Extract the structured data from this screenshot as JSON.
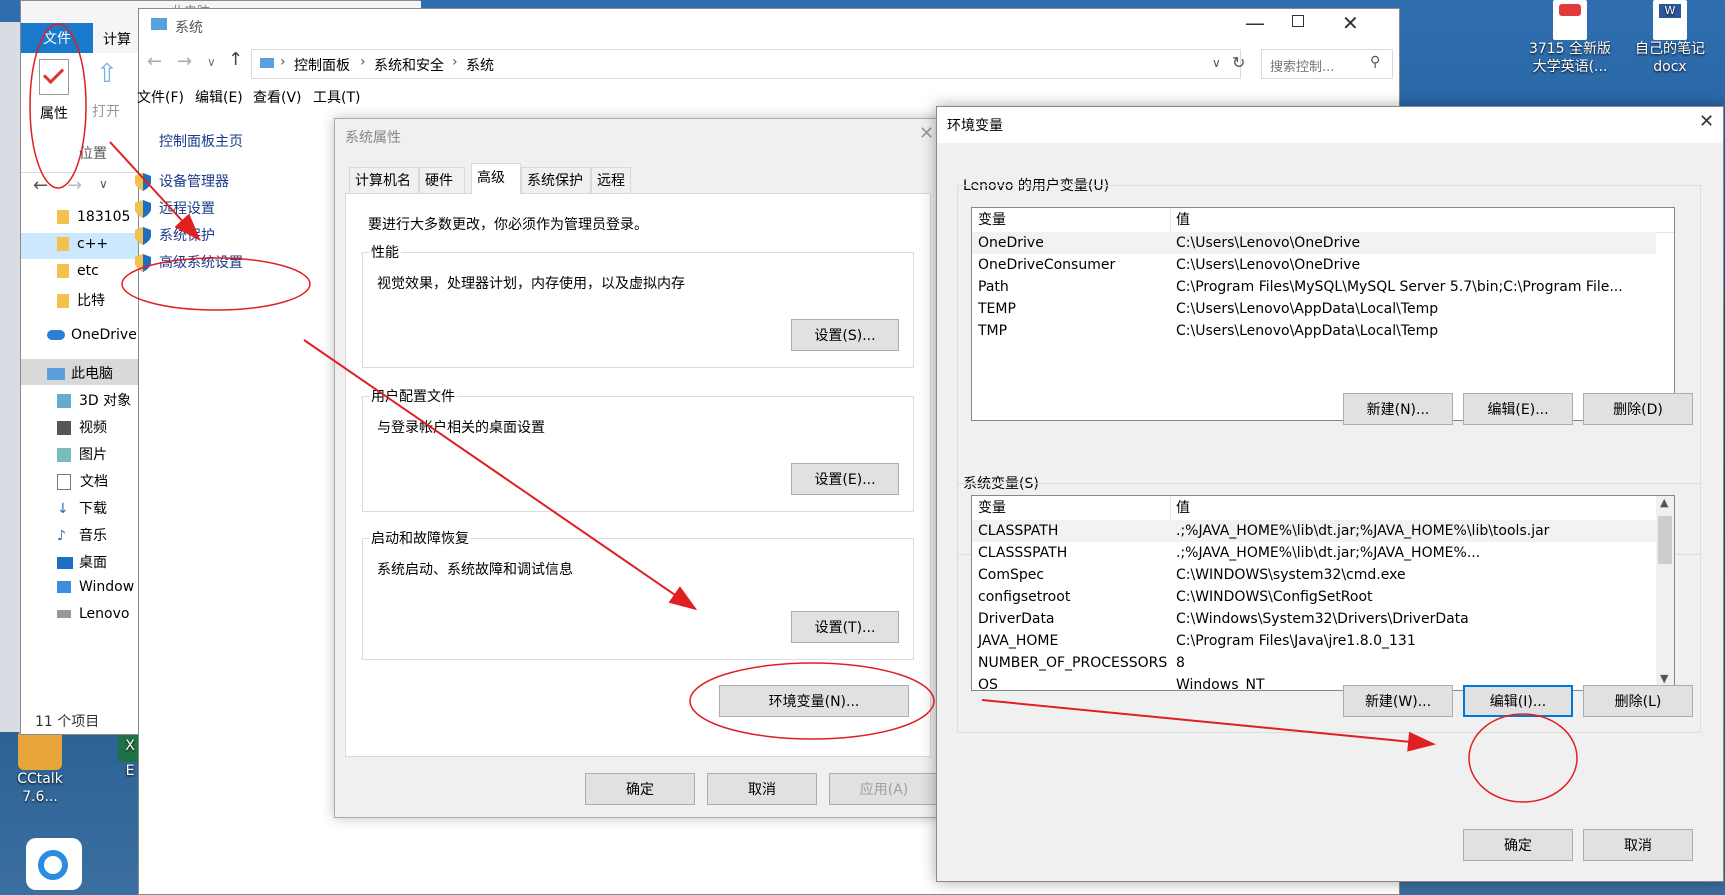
{
  "explorer": {
    "ribbon_tabs": [
      "文件",
      "计算"
    ],
    "ribbon_buttons": [
      "属性",
      "打开"
    ],
    "group_location": "位置",
    "tree_items": [
      "183105",
      "c++",
      "etc",
      "比特",
      "OneDrive",
      "此电脑",
      "3D 对象",
      "视频",
      "图片",
      "文档",
      "下载",
      "音乐",
      "桌面",
      "Window",
      "Lenovo"
    ],
    "status": "11 个项目",
    "title": "此电脑"
  },
  "desktop": {
    "top_icons": [
      {
        "label": "3715 全新版\n大学英语(..."
      },
      {
        "label": "自己的笔记\ndocx"
      }
    ],
    "bottom_icons": [
      {
        "label": "CCtalk 7.6..."
      },
      {
        "label": "E"
      }
    ]
  },
  "system_window": {
    "title": "系统",
    "breadcrumb": [
      "控制面板",
      "系统和安全",
      "系统"
    ],
    "search_placeholder": "搜索控制...",
    "menu": [
      "文件(F)",
      "编辑(E)",
      "查看(V)",
      "工具(T)"
    ],
    "sidebar_home": "控制面板主页",
    "sidebar_links": [
      "设备管理器",
      "远程设置",
      "系统保护",
      "高级系统设置"
    ]
  },
  "sys_props": {
    "title": "系统属性",
    "tabs": [
      "计算机名",
      "硬件",
      "高级",
      "系统保护",
      "远程"
    ],
    "notice": "要进行大多数更改，你必须作为管理员登录。",
    "groups": [
      {
        "title": "性能",
        "desc": "视觉效果，处理器计划，内存使用，以及虚拟内存",
        "button": "设置(S)..."
      },
      {
        "title": "用户配置文件",
        "desc": "与登录帐户相关的桌面设置",
        "button": "设置(E)..."
      },
      {
        "title": "启动和故障恢复",
        "desc": "系统启动、系统故障和调试信息",
        "button": "设置(T)..."
      }
    ],
    "env_button": "环境变量(N)...",
    "ok": "确定",
    "cancel": "取消",
    "apply": "应用(A)"
  },
  "env_vars": {
    "title": "环境变量",
    "user_section": "Lenovo 的用户变量(U)",
    "system_section": "系统变量(S)",
    "col_var": "变量",
    "col_val": "值",
    "user_rows": [
      {
        "name": "OneDrive",
        "value": "C:\\Users\\Lenovo\\OneDrive"
      },
      {
        "name": "OneDriveConsumer",
        "value": "C:\\Users\\Lenovo\\OneDrive"
      },
      {
        "name": "Path",
        "value": "C:\\Program Files\\MySQL\\MySQL Server 5.7\\bin;C:\\Program File..."
      },
      {
        "name": "TEMP",
        "value": "C:\\Users\\Lenovo\\AppData\\Local\\Temp"
      },
      {
        "name": "TMP",
        "value": "C:\\Users\\Lenovo\\AppData\\Local\\Temp"
      }
    ],
    "system_rows": [
      {
        "name": "CLASSPATH",
        "value": ".;%JAVA_HOME%\\lib\\dt.jar;%JAVA_HOME%\\lib\\tools.jar"
      },
      {
        "name": "CLASSSPATH",
        "value": ".;%JAVA_HOME%\\lib\\dt.jar;%JAVA_HOME%..."
      },
      {
        "name": "ComSpec",
        "value": "C:\\WINDOWS\\system32\\cmd.exe"
      },
      {
        "name": "configsetroot",
        "value": "C:\\WINDOWS\\ConfigSetRoot"
      },
      {
        "name": "DriverData",
        "value": "C:\\Windows\\System32\\Drivers\\DriverData"
      },
      {
        "name": "JAVA_HOME",
        "value": "C:\\Program Files\\Java\\jre1.8.0_131"
      },
      {
        "name": "NUMBER_OF_PROCESSORS",
        "value": "8"
      },
      {
        "name": "OS",
        "value": "Windows_NT"
      }
    ],
    "user_buttons": [
      "新建(N)...",
      "编辑(E)...",
      "删除(D)"
    ],
    "system_buttons": [
      "新建(W)...",
      "编辑(I)...",
      "删除(L)"
    ],
    "ok": "确定",
    "cancel": "取消"
  },
  "colors": {
    "annotation": "#e02020",
    "accent": "#0078d7"
  }
}
